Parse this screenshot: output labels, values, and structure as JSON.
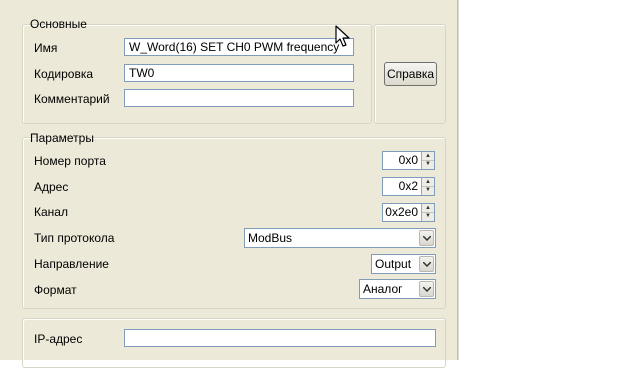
{
  "basic": {
    "group_title": "Основные",
    "name_label": "Имя",
    "name_value": "W_Word(16) SET CH0 PWM frequency",
    "encoding_label": "Кодировка",
    "encoding_value": "TW0",
    "comment_label": "Комментарий",
    "comment_value": "",
    "help_button": "Справка"
  },
  "params": {
    "group_title": "Параметры",
    "port_label": "Номер порта",
    "port_value": "0x0",
    "address_label": "Адрес",
    "address_value": "0x2",
    "channel_label": "Канал",
    "channel_value": "0x2e0",
    "protocol_label": "Тип протокола",
    "protocol_value": "ModBus",
    "direction_label": "Направление",
    "direction_value": "Output",
    "format_label": "Формат",
    "format_value": "Аналог"
  },
  "network": {
    "ip_label": "IP-адрес",
    "ip_value": ""
  },
  "icons": {
    "spin_up": "▲",
    "spin_down": "▼",
    "dropdown": "chevron-down-icon",
    "cursor": "mouse-pointer-icon"
  }
}
